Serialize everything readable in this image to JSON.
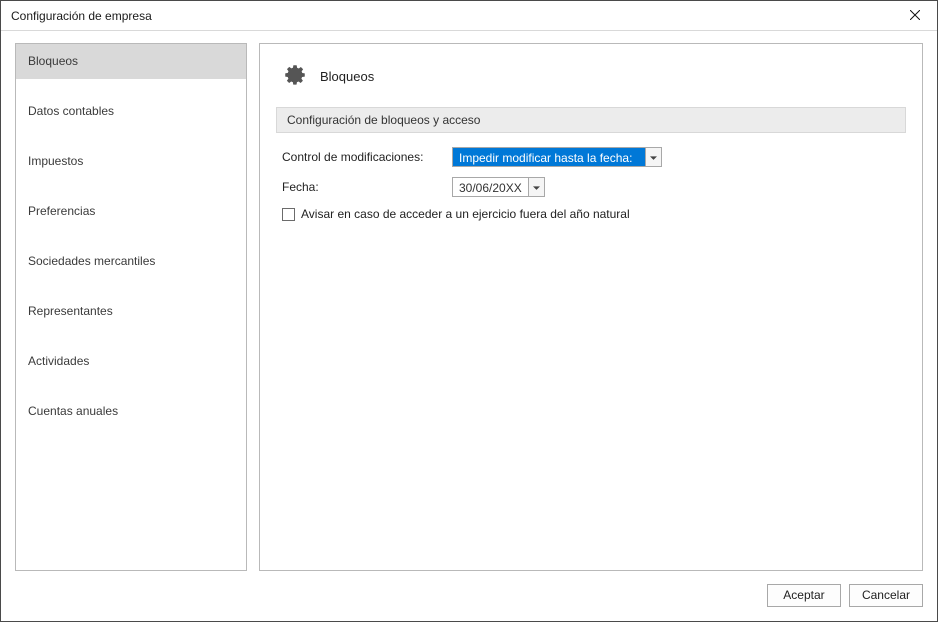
{
  "window": {
    "title": "Configuración de empresa"
  },
  "sidebar": {
    "items": [
      {
        "label": "Bloqueos",
        "selected": true
      },
      {
        "label": "Datos contables",
        "selected": false
      },
      {
        "label": "Impuestos",
        "selected": false
      },
      {
        "label": "Preferencias",
        "selected": false
      },
      {
        "label": "Sociedades mercantiles",
        "selected": false
      },
      {
        "label": "Representantes",
        "selected": false
      },
      {
        "label": "Actividades",
        "selected": false
      },
      {
        "label": "Cuentas anuales",
        "selected": false
      }
    ]
  },
  "content": {
    "section_title": "Bloqueos",
    "group_header": "Configuración de bloqueos y acceso",
    "control_label": "Control de modificaciones:",
    "control_value": "Impedir modificar hasta la fecha:",
    "date_label": "Fecha:",
    "date_value": "30/06/20XX",
    "warn_checkbox_label": "Avisar en caso de acceder a un ejercicio fuera del año natural",
    "warn_checkbox_checked": false
  },
  "footer": {
    "accept_label": "Aceptar",
    "cancel_label": "Cancelar"
  }
}
